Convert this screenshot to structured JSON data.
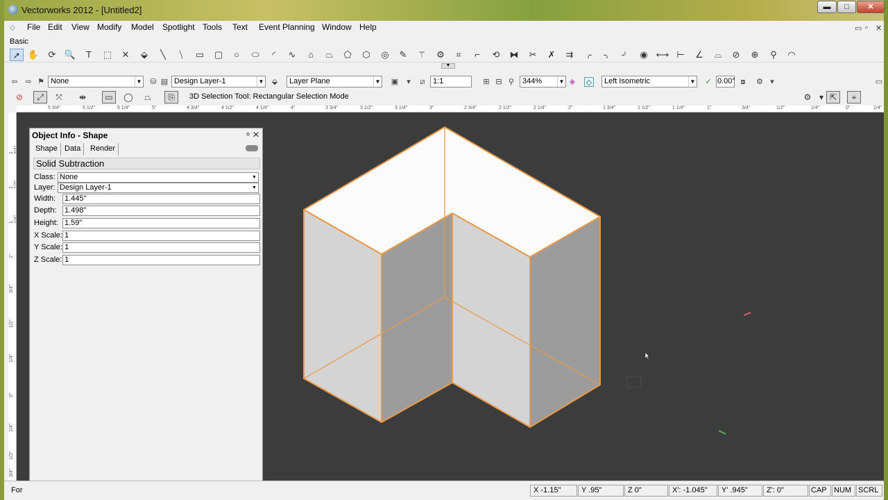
{
  "window": {
    "title": "Vectorworks 2012 - [Untitled2]",
    "buttons": {
      "minimize": "▬",
      "maximize": "□",
      "close": "✕"
    }
  },
  "menubar": {
    "items": [
      "File",
      "Edit",
      "View",
      "Modify",
      "Model",
      "Spotlight",
      "Tools",
      "Text",
      "Event Planning",
      "Window",
      "Help"
    ],
    "doc_controls": [
      "▭",
      "▫",
      "✕"
    ]
  },
  "palette": {
    "name": "Basic"
  },
  "viewbar": {
    "class_value": "None",
    "layer_value": "Design Layer-1",
    "plane_value": "Layer Plane",
    "scale_value": "1:1",
    "zoom_value": "344%",
    "view_value": "Left Isometric",
    "angle_value": "0.00°"
  },
  "modebar": {
    "tool_mode_text": "3D Selection Tool: Rectangular Selection Mode"
  },
  "ruler_h_labels": [
    "5 3/4\"",
    "5 1/2\"",
    "5 1/4\"",
    "5\"",
    "4 3/4\"",
    "4 1/2\"",
    "4 1/4\"",
    "4\"",
    "3 3/4\"",
    "3 1/2\"",
    "3 1/4\"",
    "3\"",
    "2 3/4\"",
    "2 1/2\"",
    "2 1/4\"",
    "2\"",
    "1 3/4\"",
    "1 1/2\"",
    "1 1/4\"",
    "1\"",
    "3/4\"",
    "1/2\"",
    "1/4\"",
    "0\"",
    "1/4\""
  ],
  "ruler_v_labels": [
    "1 3/4\"",
    "1 1/2\"",
    "1 1/4\"",
    "1\"",
    "3/4\"",
    "1/2\"",
    "1/4\"",
    "0\"",
    "1/4\"",
    "1/2\"",
    "3/4\""
  ],
  "object_info": {
    "title": "Object Info - Shape",
    "tabs": [
      "Shape",
      "Data",
      "Render"
    ],
    "object_type": "Solid Subtraction",
    "class_label": "Class:",
    "class_value": "None",
    "layer_label": "Layer:",
    "layer_value": "Design Layer-1",
    "fields": [
      {
        "label": "Width:",
        "value": "1.445\""
      },
      {
        "label": "Depth:",
        "value": "1.498\""
      },
      {
        "label": "Height:",
        "value": "1.59\""
      },
      {
        "label": "X Scale:",
        "value": "1"
      },
      {
        "label": "Y Scale:",
        "value": "1"
      },
      {
        "label": "Z Scale:",
        "value": "1"
      }
    ]
  },
  "status": {
    "left_text": "For",
    "x": "X -1.15\"",
    "y": "Y .95\"",
    "z": "Z 0\"",
    "xp": "X': -1.045\"",
    "yp": "Y' .945\"",
    "zp": "Z': 0\"",
    "cap": "CAP",
    "num": "NUM",
    "scrl": "SCRL"
  },
  "colors": {
    "canvas_bg": "#3c3c3c",
    "selection_edge": "#e89a4a",
    "face_top": "#fbfbfb",
    "face_light": "#d4d4d4",
    "face_dark": "#9c9c9c"
  }
}
